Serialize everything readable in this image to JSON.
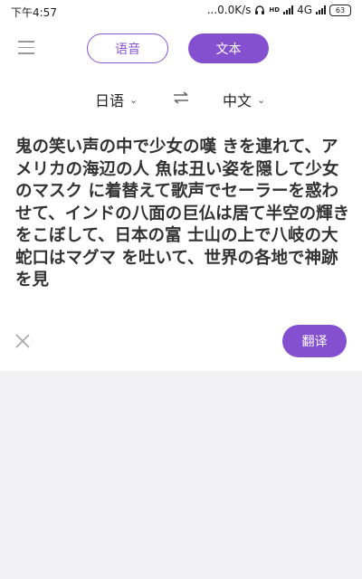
{
  "status_bar": {
    "time": "下午4:57",
    "network_speed": "...0.0K/s",
    "hd_label": "HD",
    "network_type": "4G",
    "battery": "63"
  },
  "header": {
    "menu_icon": "hamburger-menu-icon",
    "modes": [
      {
        "label": "语音",
        "selected": false
      },
      {
        "label": "文本",
        "selected": true
      }
    ]
  },
  "languages": {
    "source": "日语",
    "target": "中文",
    "swap_icon": "swap-arrows-icon"
  },
  "source_text": "鬼の笑い声の中で少女の嘆 きを連れて、アメリカの海辺の人 魚は丑い姿を隠して少女のマスク に着替えて歌声でセーラーを惑わ せて、インドの八面の巨仏は居て半空の輝きをこぼして、日本の富 士山の上で八岐の大蛇口はマグマ を吐いて、世界の各地で神跡を見",
  "actions": {
    "clear_icon": "close-icon",
    "translate_label": "翻译"
  },
  "colors": {
    "accent": "#8550d0",
    "page_background": "#f2f2f4",
    "card_background": "#ffffff",
    "text": "#333333"
  }
}
